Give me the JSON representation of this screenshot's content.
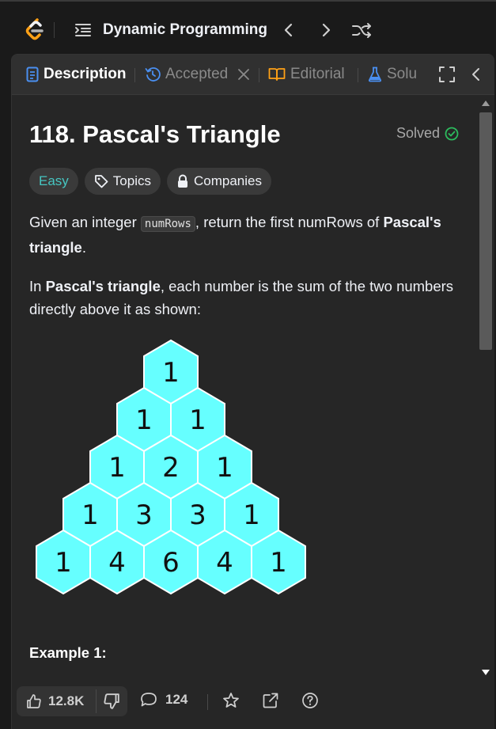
{
  "nav": {
    "title": "Dynamic Programming",
    "logo_icon": "leetcode-logo",
    "list_icon": "problem-list-icon",
    "prev_icon": "chevron-left-icon",
    "next_icon": "chevron-right-icon",
    "shuffle_icon": "shuffle-icon"
  },
  "tabs": [
    {
      "label": "Description",
      "icon": "description-icon",
      "active": true
    },
    {
      "label": "Accepted",
      "icon": "history-icon",
      "closable": true
    },
    {
      "label": "Editorial",
      "icon": "book-icon"
    },
    {
      "label": "Solu",
      "icon": "flask-icon"
    }
  ],
  "problem": {
    "title": "118. Pascal's Triangle",
    "status": "Solved",
    "tags": {
      "difficulty": "Easy",
      "topics": "Topics",
      "companies": "Companies"
    },
    "para1": {
      "pre": "Given an integer ",
      "code": "numRows",
      "mid": ", return the first numRows of ",
      "bold": "Pascal's triangle",
      "post": "."
    },
    "para2": {
      "pre": "In ",
      "bold": "Pascal's triangle",
      "post": ", each number is the sum of the two numbers directly above it as shown:"
    },
    "triangle_rows": [
      [
        1
      ],
      [
        1,
        1
      ],
      [
        1,
        2,
        1
      ],
      [
        1,
        3,
        3,
        1
      ],
      [
        1,
        4,
        6,
        4,
        1
      ]
    ],
    "example_title": "Example 1:"
  },
  "bottom": {
    "likes": "12.8K",
    "comments": "124"
  },
  "colors": {
    "accent_green": "#2cbb5d",
    "easy": "#46c6c2",
    "hex_fill": "#66ffff",
    "tab_blue": "#4a8ff0",
    "editorial_orange": "#ffa116"
  }
}
